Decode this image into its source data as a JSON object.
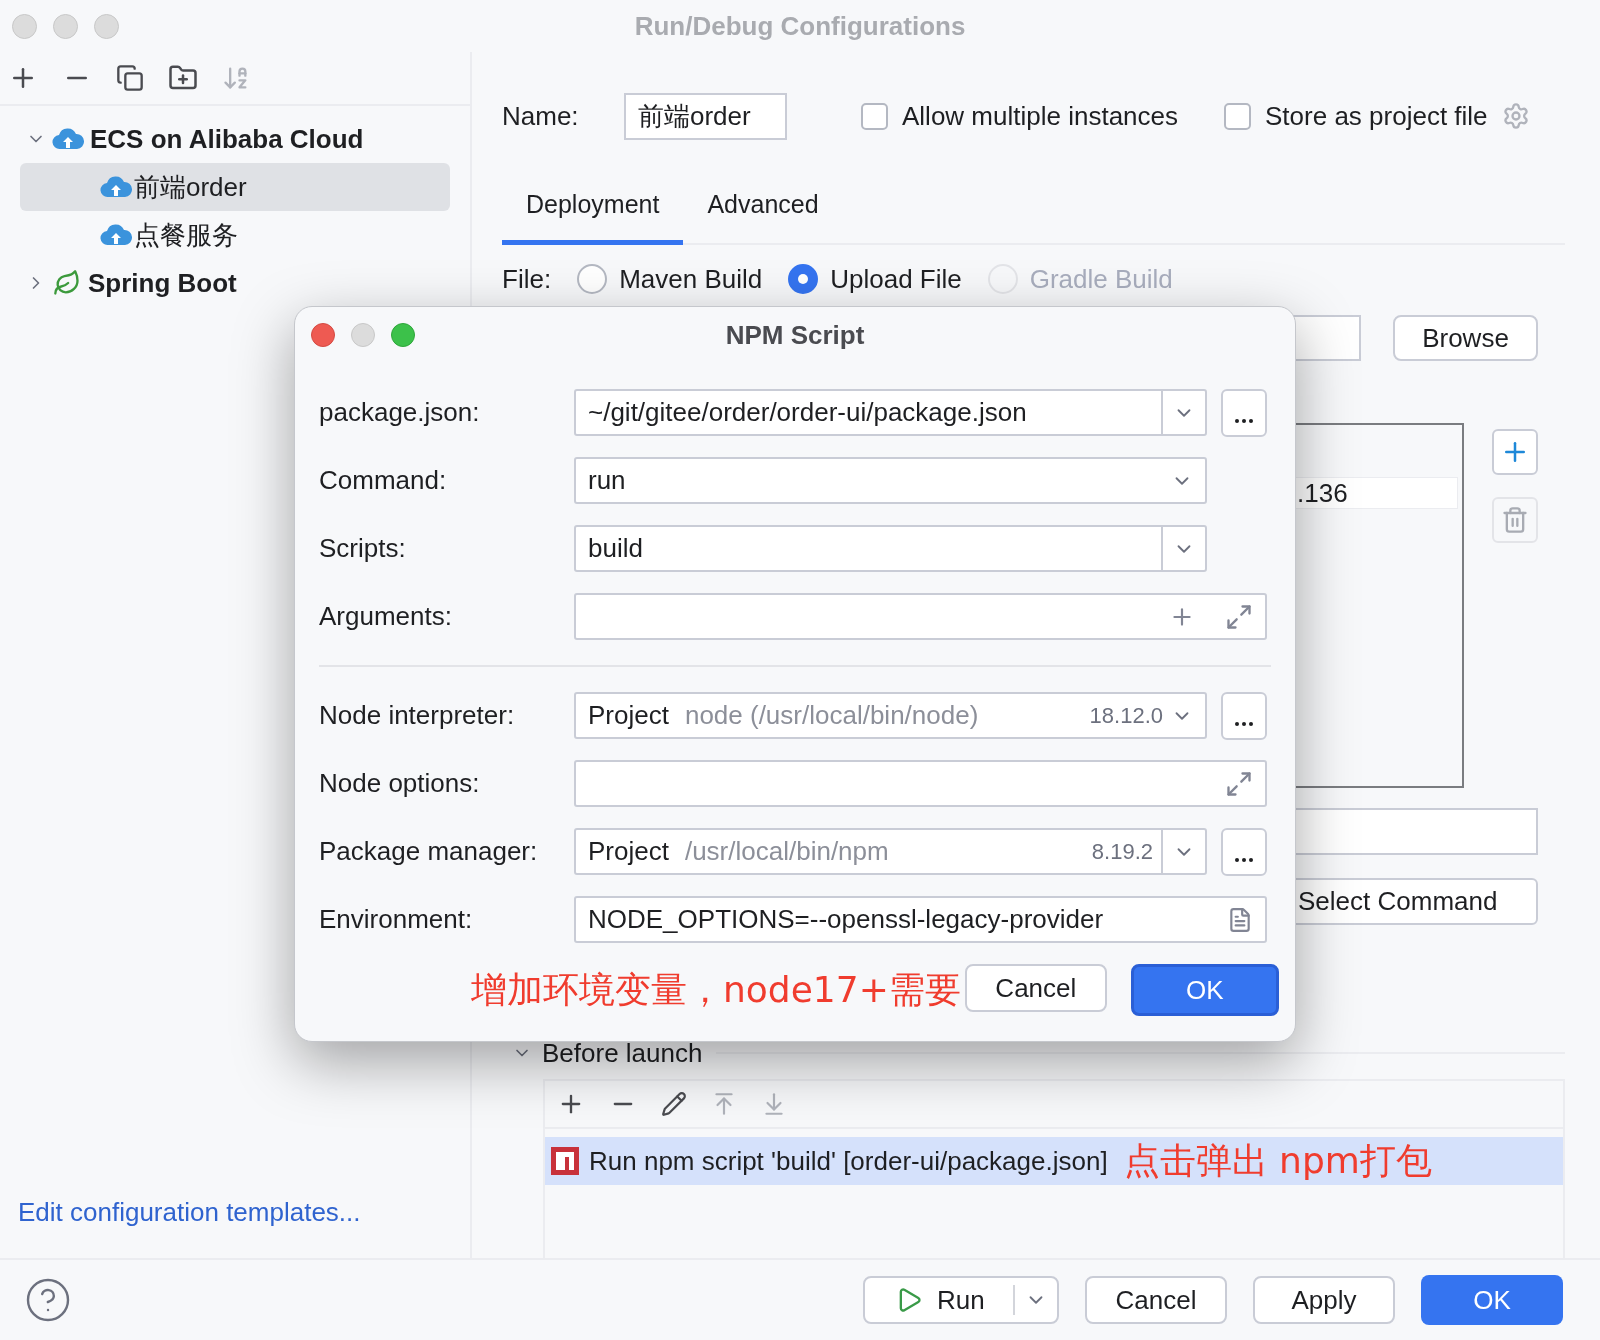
{
  "window": {
    "title": "Run/Debug Configurations"
  },
  "sidebar": {
    "tree": [
      {
        "label": "ECS on Alibaba Cloud",
        "kind": "cloud",
        "expanded": true,
        "selected": false,
        "children": [
          {
            "label": "前端order",
            "kind": "cloud",
            "selected": true
          },
          {
            "label": "点餐服务",
            "kind": "cloud",
            "selected": false
          }
        ]
      },
      {
        "label": "Spring Boot",
        "kind": "spring",
        "expanded": false,
        "selected": false
      }
    ],
    "footer_link": "Edit configuration templates..."
  },
  "config": {
    "name_label": "Name:",
    "name_value": "前端order",
    "options": [
      {
        "label": "Allow multiple instances",
        "checked": false
      },
      {
        "label": "Store as project file",
        "checked": false
      }
    ],
    "tabs": [
      {
        "label": "Deployment",
        "selected": true
      },
      {
        "label": "Advanced",
        "selected": false
      }
    ],
    "file_label": "File:",
    "file_options": [
      {
        "label": "Maven Build",
        "selected": false,
        "disabled": false
      },
      {
        "label": "Upload File",
        "selected": true,
        "disabled": false
      },
      {
        "label": "Gradle Build",
        "selected": false,
        "disabled": true
      }
    ],
    "browse_button": "Browse",
    "server_row": ".136",
    "select_command_button": "Select Command",
    "before_launch": {
      "title": "Before launch",
      "expanded": true,
      "tasks": [
        {
          "label": "Run npm script 'build' [order-ui/package.json]",
          "selected": true
        }
      ]
    },
    "annotation": "点击弹出 npm打包"
  },
  "footer": {
    "buttons": [
      {
        "label": "Run",
        "kind": "split"
      },
      {
        "label": "Cancel",
        "kind": "plain"
      },
      {
        "label": "Apply",
        "kind": "plain"
      },
      {
        "label": "OK",
        "kind": "primary"
      }
    ]
  },
  "npm_dialog": {
    "title": "NPM Script",
    "fields": [
      {
        "kind": "combo_browse",
        "label": "package.json:",
        "value": "~/git/gitee/order/order-ui/package.json"
      },
      {
        "kind": "select",
        "label": "Command:",
        "value": "run"
      },
      {
        "kind": "combo",
        "label": "Scripts:",
        "value": "build"
      },
      {
        "kind": "expandable_plus",
        "label": "Arguments:"
      }
    ],
    "node_fields": [
      {
        "kind": "select_browse",
        "label": "Node interpreter:",
        "value": "Project",
        "detail": "node (/usr/local/bin/node)",
        "version": "18.12.0"
      },
      {
        "kind": "expandable",
        "label": "Node options:"
      },
      {
        "kind": "combo_browse",
        "label": "Package manager:",
        "value": "Project",
        "detail": "/usr/local/bin/npm",
        "version": "8.19.2"
      },
      {
        "kind": "env",
        "label": "Environment:",
        "value": "NODE_OPTIONS=--openssl-legacy-provider"
      }
    ],
    "annotation": "增加环境变量，node17+需要",
    "buttons": [
      {
        "label": "Cancel",
        "kind": "plain"
      },
      {
        "label": "OK",
        "kind": "primary"
      }
    ]
  }
}
